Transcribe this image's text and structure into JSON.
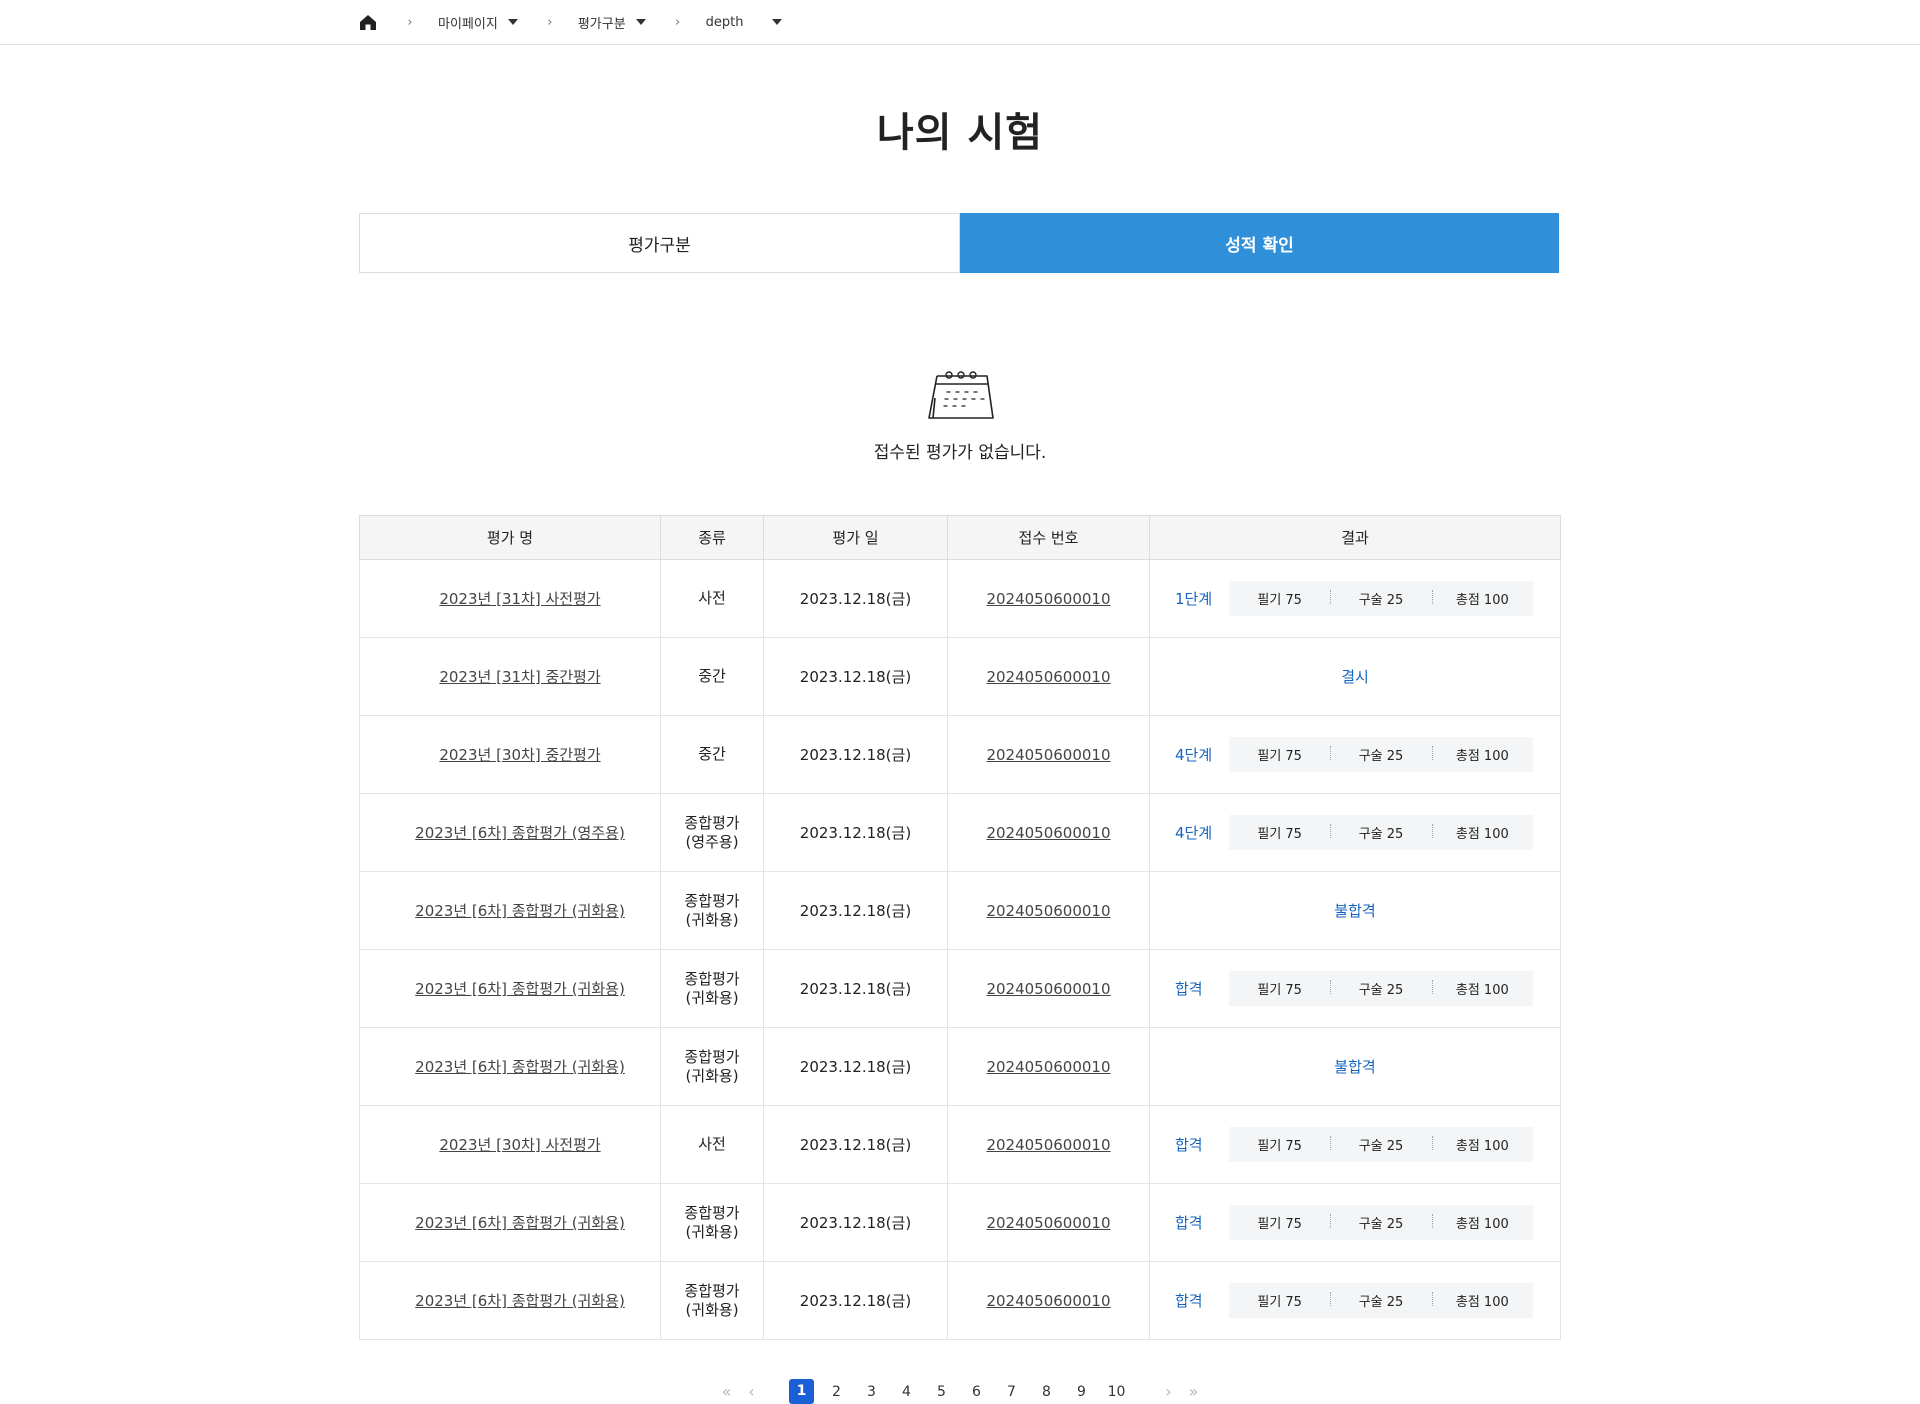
{
  "breadcrumb": {
    "home_icon": "home-icon",
    "items": [
      {
        "label": "마이페이지"
      },
      {
        "label": "평가구분"
      },
      {
        "label": "depth"
      }
    ]
  },
  "page_title": "나의 시험",
  "tabs": [
    {
      "label": "평가구분",
      "active": false
    },
    {
      "label": "성적 확인",
      "active": true
    }
  ],
  "empty_state": {
    "icon": "calendar-icon",
    "message": "접수된 평가가 없습니다."
  },
  "table": {
    "headers": [
      "평가 명",
      "종류",
      "평가 일",
      "접수 번호",
      "결과"
    ],
    "rows": [
      {
        "name": "2023년 [31차] 사전평가",
        "kind": [
          "사전"
        ],
        "date": "2023.12.18(금)",
        "receipt": "2024050600010",
        "status": "1단계",
        "has_scores": true,
        "written": "필기 75",
        "oral": "구술 25",
        "total": "총점 100"
      },
      {
        "name": "2023년 [31차] 중간평가",
        "kind": [
          "중간"
        ],
        "date": "2023.12.18(금)",
        "receipt": "2024050600010",
        "status": "결시",
        "has_scores": false
      },
      {
        "name": "2023년 [30차] 중간평가",
        "kind": [
          "중간"
        ],
        "date": "2023.12.18(금)",
        "receipt": "2024050600010",
        "status": "4단계",
        "has_scores": true,
        "written": "필기 75",
        "oral": "구술 25",
        "total": "총점 100"
      },
      {
        "name": "2023년 [6차] 종합평가 (영주용)",
        "kind": [
          "종합평가",
          "(영주용)"
        ],
        "date": "2023.12.18(금)",
        "receipt": "2024050600010",
        "status": "4단계",
        "has_scores": true,
        "written": "필기 75",
        "oral": "구술 25",
        "total": "총점 100"
      },
      {
        "name": "2023년 [6차] 종합평가 (귀화용)",
        "kind": [
          "종합평가",
          "(귀화용)"
        ],
        "date": "2023.12.18(금)",
        "receipt": "2024050600010",
        "status": "불합격",
        "has_scores": false
      },
      {
        "name": "2023년 [6차] 종합평가 (귀화용)",
        "kind": [
          "종합평가",
          "(귀화용)"
        ],
        "date": "2023.12.18(금)",
        "receipt": "2024050600010",
        "status": "합격",
        "has_scores": true,
        "written": "필기 75",
        "oral": "구술 25",
        "total": "총점 100"
      },
      {
        "name": "2023년 [6차] 종합평가 (귀화용)",
        "kind": [
          "종합평가",
          "(귀화용)"
        ],
        "date": "2023.12.18(금)",
        "receipt": "2024050600010",
        "status": "불합격",
        "has_scores": false
      },
      {
        "name": "2023년 [30차] 사전평가",
        "kind": [
          "사전"
        ],
        "date": "2023.12.18(금)",
        "receipt": "2024050600010",
        "status": "합격",
        "has_scores": true,
        "written": "필기 75",
        "oral": "구술 25",
        "total": "총점 100"
      },
      {
        "name": "2023년 [6차] 종합평가 (귀화용)",
        "kind": [
          "종합평가",
          "(귀화용)"
        ],
        "date": "2023.12.18(금)",
        "receipt": "2024050600010",
        "status": "합격",
        "has_scores": true,
        "written": "필기 75",
        "oral": "구술 25",
        "total": "총점 100"
      },
      {
        "name": "2023년 [6차] 종합평가 (귀화용)",
        "kind": [
          "종합평가",
          "(귀화용)"
        ],
        "date": "2023.12.18(금)",
        "receipt": "2024050600010",
        "status": "합격",
        "has_scores": true,
        "written": "필기 75",
        "oral": "구술 25",
        "total": "총점 100"
      }
    ]
  },
  "pagination": {
    "current": "1",
    "pages": [
      "1",
      "2",
      "3",
      "4",
      "5",
      "6",
      "7",
      "8",
      "9",
      "10"
    ],
    "first_icon": "double-chevron-left-icon",
    "prev_icon": "chevron-left-icon",
    "next_icon": "chevron-right-icon",
    "last_icon": "double-chevron-right-icon"
  },
  "colors": {
    "accent_tab": "#2f8fd8",
    "status_blue": "#1565c0",
    "pager_active": "#1a5fd8"
  }
}
